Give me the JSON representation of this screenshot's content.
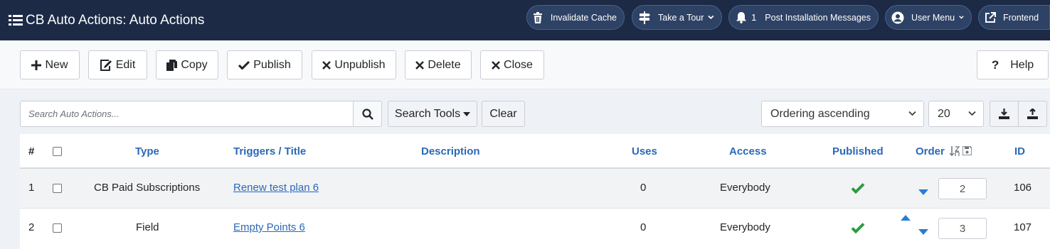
{
  "header": {
    "title": "CB Auto Actions: Auto Actions",
    "buttons": {
      "invalidate_cache": "Invalidate Cache",
      "take_tour": "Take a Tour",
      "post_install_count": "1",
      "post_install": "Post Installation Messages",
      "user_menu": "User Menu",
      "frontend": "Frontend"
    }
  },
  "toolbar": {
    "new": "New",
    "edit": "Edit",
    "copy": "Copy",
    "publish": "Publish",
    "unpublish": "Unpublish",
    "delete": "Delete",
    "close": "Close",
    "help": "Help"
  },
  "search": {
    "placeholder": "Search Auto Actions...",
    "search_tools": "Search Tools",
    "clear": "Clear",
    "ordering": "Ordering ascending",
    "limit": "20"
  },
  "table": {
    "headers": {
      "num": "#",
      "type": "Type",
      "triggers": "Triggers / Title",
      "description": "Description",
      "uses": "Uses",
      "access": "Access",
      "published": "Published",
      "order": "Order",
      "id": "ID"
    },
    "rows": [
      {
        "num": "1",
        "type": "CB Paid Subscriptions",
        "title": "Renew test plan 6",
        "description": "",
        "uses": "0",
        "access": "Everybody",
        "published": true,
        "order": "2",
        "id": "106"
      },
      {
        "num": "2",
        "type": "Field",
        "title": "Empty Points 6",
        "description": "",
        "uses": "0",
        "access": "Everybody",
        "published": true,
        "order": "3",
        "id": "107"
      }
    ]
  },
  "colors": {
    "header_bg": "#1c2a45",
    "link": "#2a69b8",
    "published_check": "#2a9d3f"
  }
}
